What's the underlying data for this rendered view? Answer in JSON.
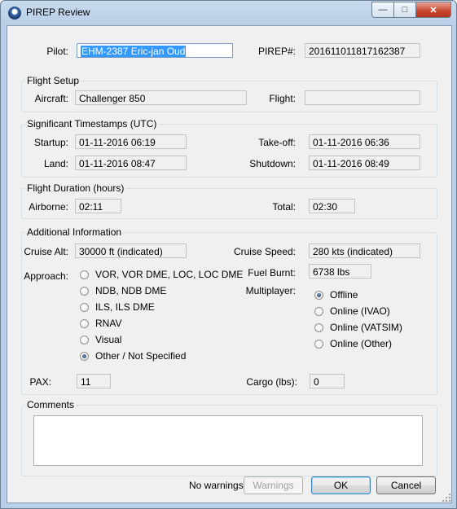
{
  "window": {
    "title": "PIREP Review",
    "controls": {
      "minimize": "—",
      "maximize": "□",
      "close": "✕"
    }
  },
  "pilot": {
    "label": "Pilot:",
    "value": "EHM-2387 Eric-jan Oud"
  },
  "pirep": {
    "label": "PIREP#:",
    "value": "201611011817162387"
  },
  "flight_setup": {
    "title": "Flight Setup",
    "aircraft_label": "Aircraft:",
    "aircraft_value": "Challenger 850",
    "flight_label": "Flight:",
    "flight_value": ""
  },
  "timestamps": {
    "title": "Significant Timestamps (UTC)",
    "startup_label": "Startup:",
    "startup_value": "01-11-2016 06:19",
    "takeoff_label": "Take-off:",
    "takeoff_value": "01-11-2016 06:36",
    "land_label": "Land:",
    "land_value": "01-11-2016 08:47",
    "shutdown_label": "Shutdown:",
    "shutdown_value": "01-11-2016 08:49"
  },
  "duration": {
    "title": "Flight Duration (hours)",
    "airborne_label": "Airborne:",
    "airborne_value": "02:11",
    "total_label": "Total:",
    "total_value": "02:30"
  },
  "additional": {
    "title": "Additional Information",
    "cruise_alt_label": "Cruise Alt:",
    "cruise_alt_value": "30000 ft (indicated)",
    "cruise_speed_label": "Cruise Speed:",
    "cruise_speed_value": "280 kts (indicated)",
    "approach_label": "Approach:",
    "approach_options": [
      {
        "label": "VOR, VOR DME, LOC, LOC DME",
        "checked": false
      },
      {
        "label": "NDB, NDB DME",
        "checked": false
      },
      {
        "label": "ILS, ILS DME",
        "checked": false
      },
      {
        "label": "RNAV",
        "checked": false
      },
      {
        "label": "Visual",
        "checked": false
      },
      {
        "label": "Other / Not Specified",
        "checked": true
      }
    ],
    "fuel_label": "Fuel Burnt:",
    "fuel_value": "6738 lbs",
    "multiplayer_label": "Multiplayer:",
    "multiplayer_options": [
      {
        "label": "Offline",
        "checked": true
      },
      {
        "label": "Online (IVAO)",
        "checked": false
      },
      {
        "label": "Online (VATSIM)",
        "checked": false
      },
      {
        "label": "Online (Other)",
        "checked": false
      }
    ],
    "pax_label": "PAX:",
    "pax_value": "11",
    "cargo_label": "Cargo (lbs):",
    "cargo_value": "0"
  },
  "comments": {
    "title": "Comments",
    "value": ""
  },
  "footer": {
    "status": "No warnings",
    "warnings_button": "Warnings",
    "ok_button": "OK",
    "cancel_button": "Cancel"
  }
}
